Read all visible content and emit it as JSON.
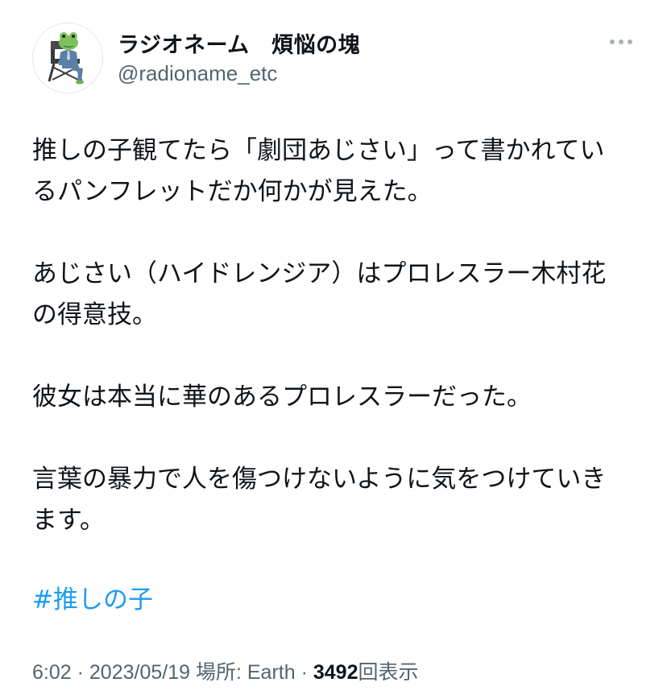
{
  "user": {
    "display_name": "ラジオネーム　煩悩の塊",
    "handle": "@radioname_etc",
    "avatar_icon": "frog-sitting-in-chair-avatar-icon"
  },
  "more_icon": "more-horizontal-icon",
  "tweet": {
    "paragraphs": [
      "推しの子観てたら「劇団あじさい」って書かれてい\nるパンフレットだか何かが見えた。",
      "あじさい（ハイドレンジア）はプロレスラー木村花\nの得意技。",
      "彼女は本当に華のあるプロレスラーだった。",
      "言葉の暴力で人を傷つけないように気をつけていき\nます。"
    ],
    "hashtag": "#推しの子"
  },
  "meta": {
    "time": "6:02",
    "separator": "·",
    "date": "2023/05/19",
    "location_label": "場所: Earth",
    "views_count": "3492",
    "views_label": "回表示"
  },
  "colors": {
    "text": "#0f1419",
    "secondary": "#536471",
    "link": "#1d9bf0"
  }
}
